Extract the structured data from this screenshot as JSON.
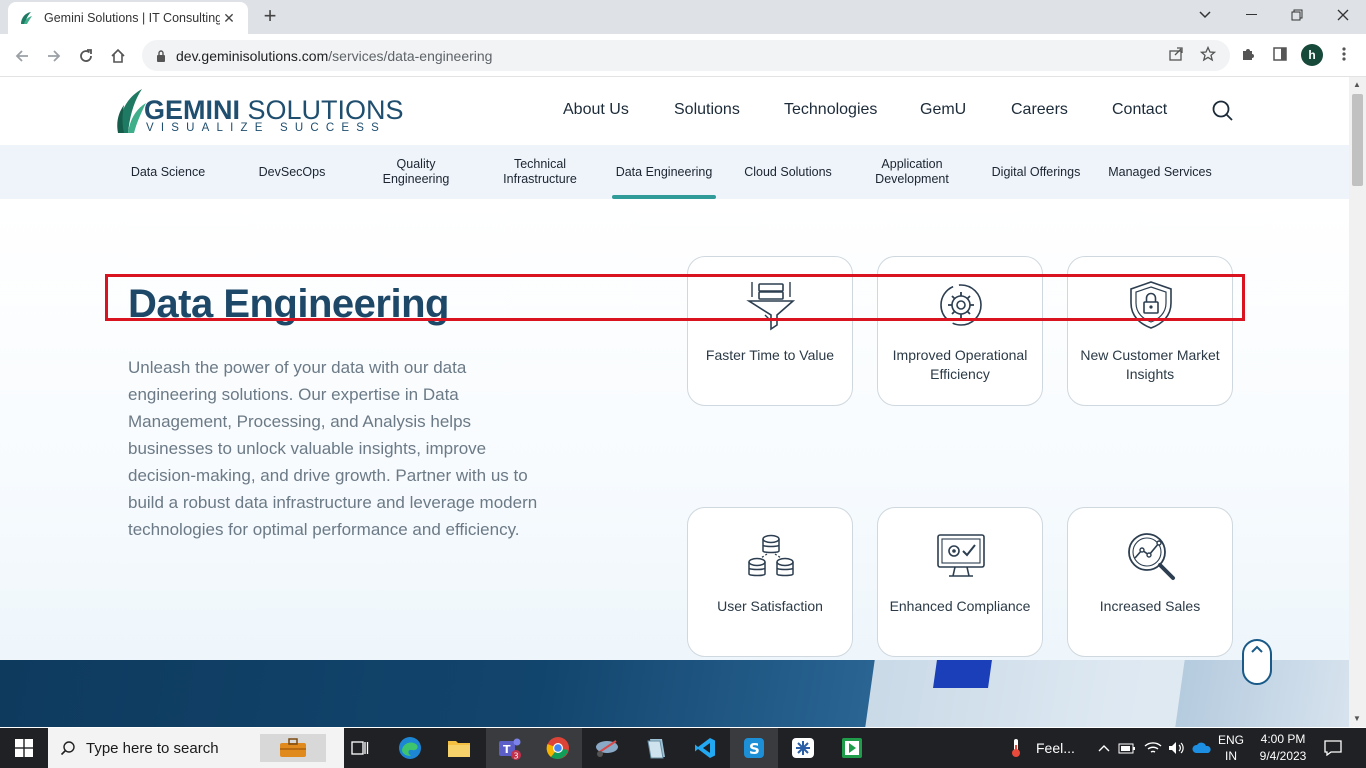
{
  "browser": {
    "tab_title": "Gemini Solutions | IT Consulting,",
    "tab_close": "✕",
    "new_tab": "+",
    "url_host": "dev.geminisolutions.com",
    "url_path": "/services/data-engineering",
    "profile_initial": "h"
  },
  "site": {
    "logo_gemini": "GEMINI",
    "logo_solutions": " SOLUTIONS",
    "logo_tagline": "VISUALIZE SUCCESS",
    "nav": [
      "About Us",
      "Solutions",
      "Technologies",
      "GemU",
      "Careers",
      "Contact"
    ],
    "subnav": [
      "Data Science",
      "DevSecOps",
      "Quality Engineering",
      "Technical Infrastructure",
      "Data Engineering",
      "Cloud Solutions",
      "Application Development",
      "Digital Offerings",
      "Managed Services"
    ],
    "subnav_active": "Data Engineering"
  },
  "hero": {
    "title": "Data Engineering",
    "description": "Unleash the power of your data with our data engineering solutions. Our expertise in Data Management, Processing, and Analysis helps businesses to unlock valuable insights, improve decision-making, and drive growth. Partner with us to build a robust data infrastructure and leverage modern technologies for optimal performance and efficiency."
  },
  "cards": [
    {
      "label": "Faster Time to Value",
      "icon": "funnel-server-icon"
    },
    {
      "label": "Improved Operational Efficiency",
      "icon": "gear-cycle-icon"
    },
    {
      "label": "New Customer Market Insights",
      "icon": "shield-lock-icon"
    },
    {
      "label": "User Satisfaction",
      "icon": "database-stack-icon"
    },
    {
      "label": "Enhanced Compliance",
      "icon": "monitor-check-icon"
    },
    {
      "label": "Increased Sales",
      "icon": "magnifier-chart-icon"
    }
  ],
  "taskbar": {
    "search_placeholder": "Type here to search",
    "weather": "Feel...",
    "lang_1": "ENG",
    "lang_2": "IN",
    "time": "4:00 PM",
    "date": "9/4/2023",
    "teams_badge": "3"
  },
  "colors": {
    "brand_navy": "#1e4868",
    "active_teal": "#2f9c99",
    "highlight_red": "#d9131f"
  }
}
